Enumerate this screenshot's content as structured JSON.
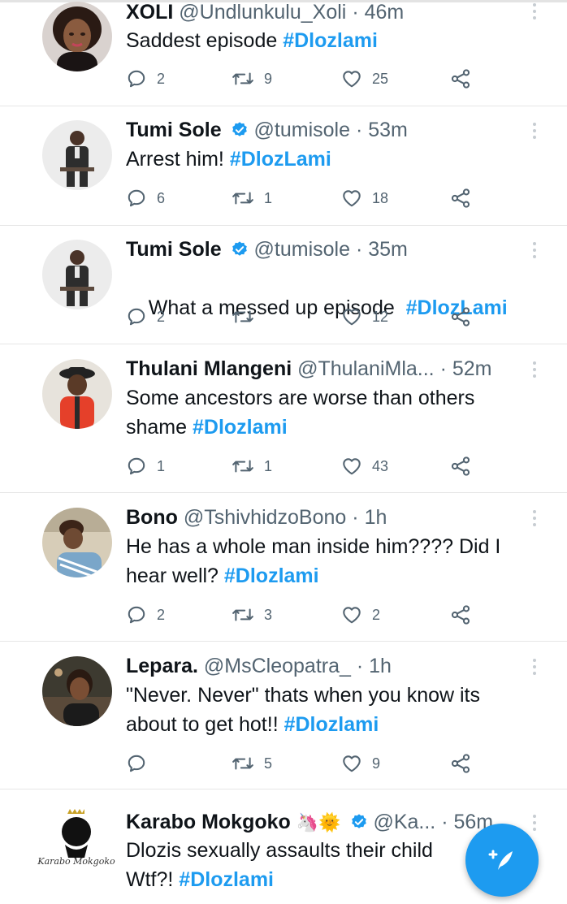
{
  "tweets": [
    {
      "name": "XOLI",
      "handle": "@Undlunkulu_Xoli",
      "time": "46m",
      "text": "Saddest episode ",
      "hashtag": "#Dlozlami",
      "replies": "2",
      "retweets": "9",
      "likes": "25"
    },
    {
      "name": "Tumi Sole",
      "handle": "@tumisole",
      "time": "53m",
      "text": "Arrest him! ",
      "hashtag": "#DlozLami",
      "replies": "6",
      "retweets": "1",
      "likes": "18"
    },
    {
      "name": "Tumi Sole",
      "handle": "@tumisole",
      "time": "35m",
      "text": "What a messed up episode  ",
      "hashtag": "#DlozLami",
      "replies": "2",
      "retweets": "",
      "likes": "12"
    },
    {
      "name": "Thulani Mlangeni",
      "handle": "@ThulaniMla...",
      "time": "52m",
      "text": "Some ancestors are worse than others shame ",
      "hashtag": "#Dlozlami",
      "replies": "1",
      "retweets": "1",
      "likes": "43"
    },
    {
      "name": "Bono",
      "handle": "@TshivhidzoBono",
      "time": "1h",
      "text": "He has a whole man inside him???? Did I hear well? ",
      "hashtag": "#Dlozlami",
      "replies": "2",
      "retweets": "3",
      "likes": "2"
    },
    {
      "name": "Lepara.",
      "handle": "@MsCleopatra_",
      "time": "1h",
      "text": "\"Never. Never\" thats when you know its about to get hot!! ",
      "hashtag": "#Dlozlami",
      "replies": "",
      "retweets": "5",
      "likes": "9"
    },
    {
      "name": "Karabo Mokgoko",
      "handle": "@Ka...",
      "time": "56m",
      "emoji": "🦄🌞",
      "text": "Dlozis sexually assaults their child",
      "text2": "Wtf?! ",
      "hashtag": "#Dlozlami",
      "logo_text": "Karabo Mokgoko"
    }
  ],
  "separator": "·",
  "colors": {
    "accent": "#1d9bf0",
    "muted": "#536471",
    "text": "#0f1419"
  },
  "icons": {
    "reply": "reply-icon",
    "retweet": "retweet-icon",
    "like": "heart-icon",
    "share": "share-icon",
    "compose": "compose-tweet-icon",
    "more": "more-options-icon",
    "verified": "verified-badge-icon"
  }
}
